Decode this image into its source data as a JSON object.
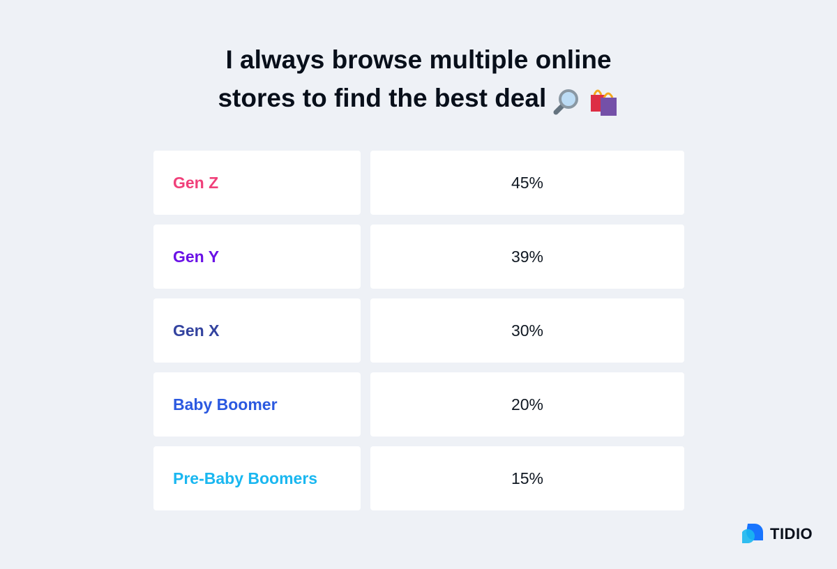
{
  "chart_data": {
    "type": "table",
    "title": "I always browse multiple online stores to find the best deal",
    "title_lines": [
      "I always browse multiple online",
      "stores to find the best deal"
    ],
    "title_icons": [
      "magnifying-glass-icon",
      "shopping-bags-icon"
    ],
    "categories": [
      "Gen Z",
      "Gen Y",
      "Gen X",
      "Baby Boomer",
      "Pre-Baby Boomers"
    ],
    "values": [
      45,
      39,
      30,
      20,
      15
    ],
    "value_labels": [
      "45%",
      "39%",
      "30%",
      "20%",
      "15%"
    ],
    "category_colors": [
      "#f0407a",
      "#6a11e6",
      "#33439f",
      "#2b59e0",
      "#1ab7f0"
    ],
    "unit": "%"
  },
  "brand": {
    "name": "TIDIO",
    "colors": {
      "primary": "#0066ff",
      "secondary": "#1ab7f0"
    }
  }
}
